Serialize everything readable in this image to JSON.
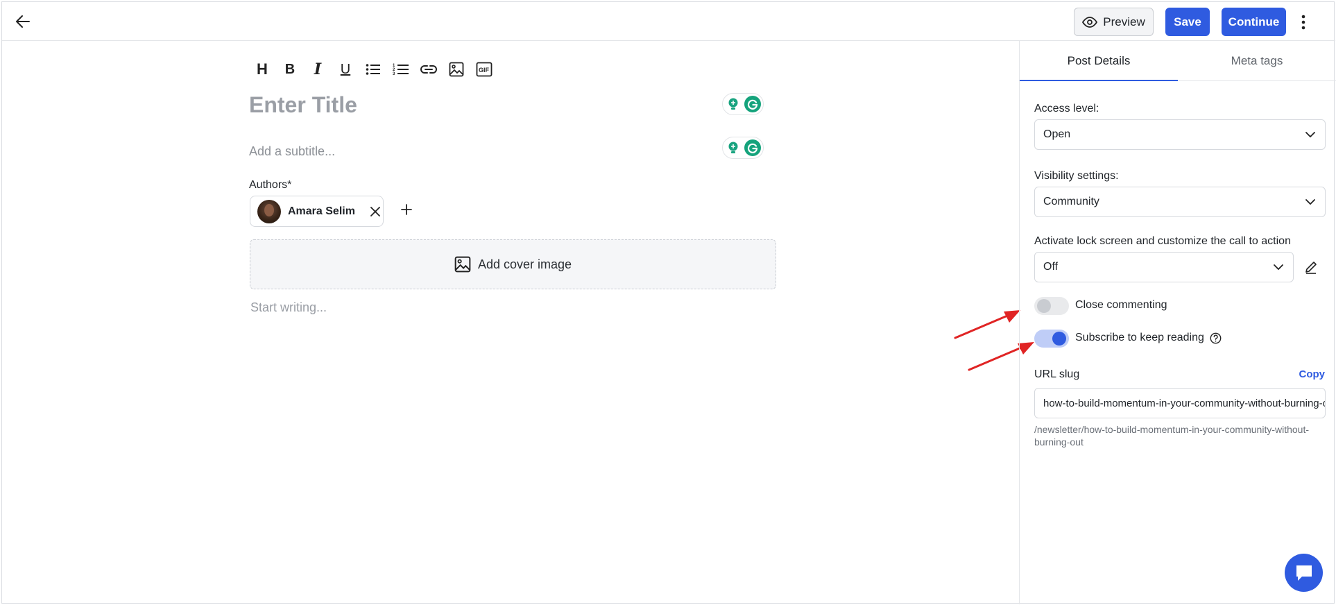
{
  "header": {
    "preview_label": "Preview",
    "save_label": "Save",
    "continue_label": "Continue"
  },
  "editor": {
    "toolbar": [
      "heading-icon",
      "bold-icon",
      "italic-icon",
      "underline-icon",
      "bullet-list-icon",
      "numbered-list-icon",
      "link-icon",
      "image-icon",
      "gif-icon"
    ],
    "toolbar_labels": {
      "heading": "H",
      "bold": "B",
      "italic": "I",
      "underline": "U",
      "gif": "GIF"
    },
    "title_placeholder": "Enter Title",
    "subtitle_placeholder": "Add a subtitle...",
    "authors_label": "Authors*",
    "author_name": "Amara Selim",
    "cover_label": "Add cover image",
    "body_placeholder": "Start writing..."
  },
  "panel": {
    "tabs": [
      {
        "label": "Post Details"
      },
      {
        "label": "Meta tags"
      }
    ],
    "access_label": "Access level:",
    "access_value": "Open",
    "visibility_label": "Visibility settings:",
    "visibility_value": "Community",
    "lock_label": "Activate lock screen and customize the call to action",
    "lock_value": "Off",
    "close_commenting_label": "Close commenting",
    "close_commenting_on": false,
    "subscribe_label": "Subscribe to keep reading",
    "subscribe_on": true,
    "url_slug_label": "URL slug",
    "copy_label": "Copy",
    "url_slug_value": "how-to-build-momentum-in-your-community-without-burning-out",
    "url_path": "/newsletter/how-to-build-momentum-in-your-community-without-burning-out"
  },
  "colors": {
    "accent": "#2f5be0",
    "annotation_arrow": "#e02424",
    "grammarly": "#15a37c"
  }
}
